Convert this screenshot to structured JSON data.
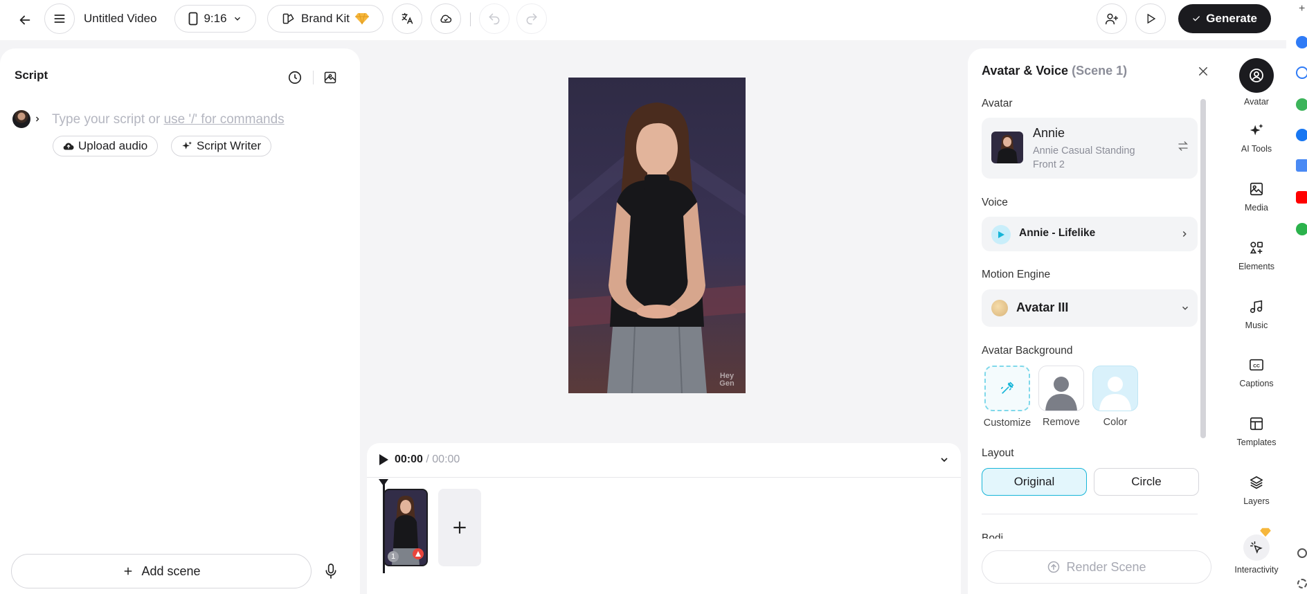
{
  "topbar": {
    "title": "Untitled Video",
    "aspect": "9:16",
    "brand_kit": "Brand Kit",
    "generate": "Generate"
  },
  "script": {
    "title": "Script",
    "placeholder_prefix": "Type your script or ",
    "placeholder_link": "use '/' for commands",
    "upload_audio": "Upload audio",
    "script_writer": "Script Writer",
    "add_scene": "Add scene"
  },
  "preview": {
    "watermark": "Hey Gen"
  },
  "timeline": {
    "current": "00:00",
    "separator": " / ",
    "total": "00:00",
    "scene_number": "1"
  },
  "panel": {
    "title": "Avatar & Voice",
    "scene_tag": "(Scene 1)",
    "avatar_label": "Avatar",
    "avatar_name": "Annie",
    "avatar_desc": "Annie Casual Standing Front 2",
    "voice_label": "Voice",
    "voice_name": "Annie - Lifelike",
    "motion_label": "Motion Engine",
    "motion_value": "Avatar III",
    "bg_label": "Avatar Background",
    "bg_options": [
      "Customize",
      "Remove",
      "Color"
    ],
    "layout_label": "Layout",
    "layout_options": [
      "Original",
      "Circle"
    ],
    "layout_selected": "Original",
    "next_section_partial": "Bodi",
    "render": "Render Scene"
  },
  "rail": {
    "items": [
      {
        "label": "Avatar",
        "icon": "avatar-icon",
        "active": true
      },
      {
        "label": "AI Tools",
        "icon": "sparkle-icon"
      },
      {
        "label": "Media",
        "icon": "image-icon"
      },
      {
        "label": "Elements",
        "icon": "elements-icon"
      },
      {
        "label": "Music",
        "icon": "music-icon"
      },
      {
        "label": "Captions",
        "icon": "captions-icon"
      },
      {
        "label": "Templates",
        "icon": "templates-icon"
      },
      {
        "label": "Layers",
        "icon": "layers-icon"
      },
      {
        "label": "Interactivity",
        "icon": "interactivity-icon"
      }
    ]
  },
  "colors": {
    "accent": "#16b5d8",
    "accent_bg": "#e3f6fc",
    "dark": "#1b1b1f",
    "muted": "#8b8d98"
  }
}
